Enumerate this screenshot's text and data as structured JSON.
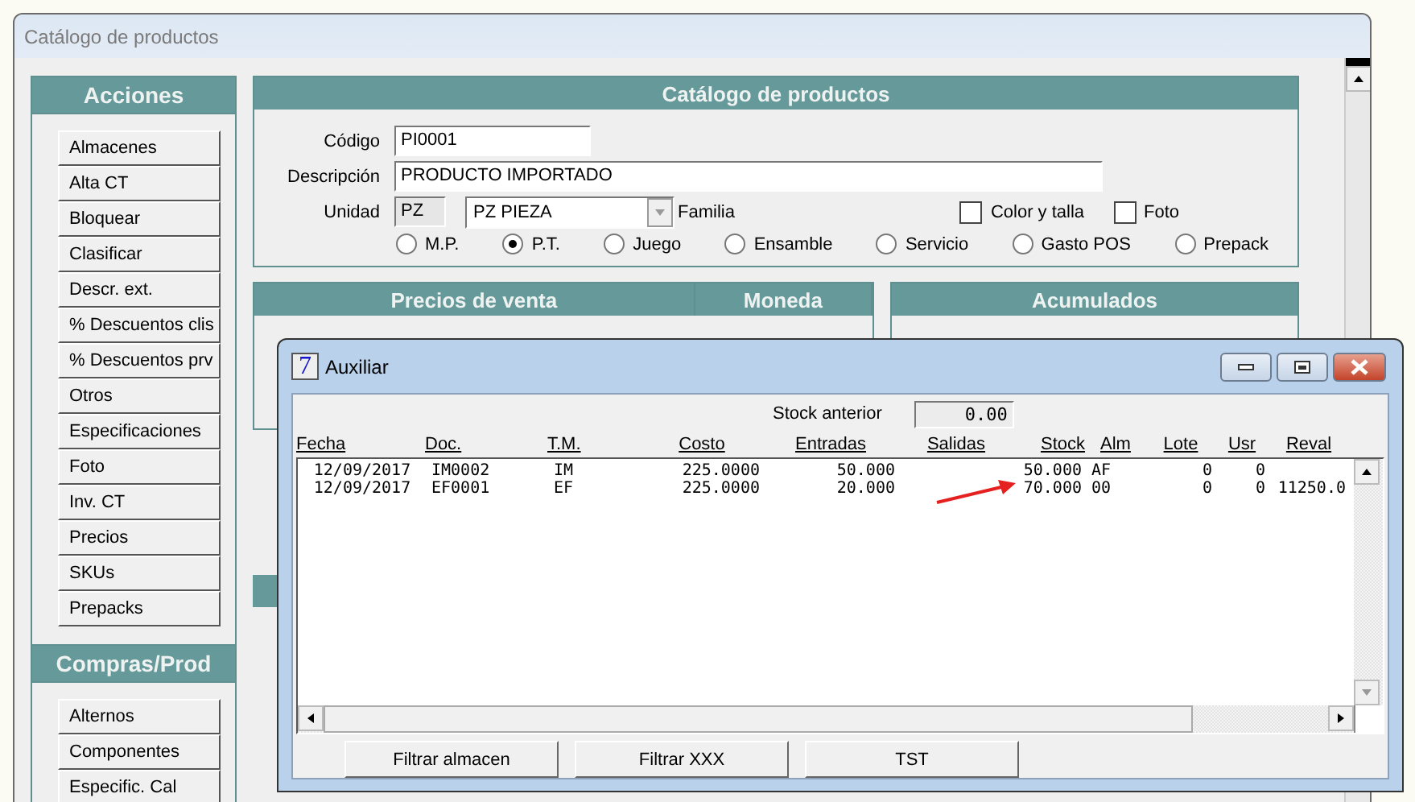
{
  "main_window": {
    "title": "Catálogo de productos"
  },
  "sidebar": {
    "sections": [
      {
        "title": "Acciones",
        "items": [
          "Almacenes",
          "Alta CT",
          "Bloquear",
          "Clasificar",
          "Descr. ext.",
          "% Descuentos clis",
          "% Descuentos prv",
          "Otros",
          "Especificaciones",
          "Foto",
          "Inv. CT",
          "Precios",
          "SKUs",
          "Prepacks"
        ]
      },
      {
        "title": "Compras/Prod",
        "items": [
          "Alternos",
          "Componentes",
          "Especific. Cal"
        ]
      }
    ]
  },
  "product_panel": {
    "title": "Catálogo de productos",
    "codigo": {
      "label": "Código",
      "value": "PI0001"
    },
    "descripcion": {
      "label": "Descripción",
      "value": "PRODUCTO IMPORTADO"
    },
    "unidad": {
      "label": "Unidad",
      "code": "PZ",
      "value": "PZ  PIEZA"
    },
    "familia_label": "Familia",
    "checkboxes": [
      {
        "label": "Color y talla",
        "checked": false
      },
      {
        "label": "Foto",
        "checked": false
      }
    ],
    "types": [
      {
        "label": "M.P.",
        "selected": false
      },
      {
        "label": "P.T.",
        "selected": true
      },
      {
        "label": "Juego",
        "selected": false
      },
      {
        "label": "Ensamble",
        "selected": false
      },
      {
        "label": "Servicio",
        "selected": false
      },
      {
        "label": "Gasto POS",
        "selected": false
      },
      {
        "label": "Prepack",
        "selected": false
      }
    ]
  },
  "price_panel": {
    "headers": [
      "Precios de venta",
      "Moneda"
    ]
  },
  "totals_panel": {
    "title": "Acumulados"
  },
  "dialog": {
    "title": "Auxiliar",
    "icon_glyph": "7",
    "stock_anterior": {
      "label": "Stock anterior",
      "value": "0.00"
    },
    "columns": [
      "Fecha",
      "Doc.",
      "T.M.",
      "Costo",
      "Entradas",
      "Salidas",
      "Stock",
      "Alm",
      "Lote",
      "Usr",
      "Reval"
    ],
    "rows": [
      [
        "12/09/2017",
        "IM0002",
        "IM",
        "225.0000",
        "50.000",
        null,
        "50.000",
        "AF",
        "0",
        "0",
        null
      ],
      [
        "12/09/2017",
        "EF0001",
        "EF",
        "225.0000",
        "20.000",
        null,
        "70.000",
        "00",
        "0",
        "0",
        "11250.0"
      ]
    ],
    "buttons": [
      "Filtrar  almacen",
      "Filtrar XXX",
      "TST"
    ]
  }
}
